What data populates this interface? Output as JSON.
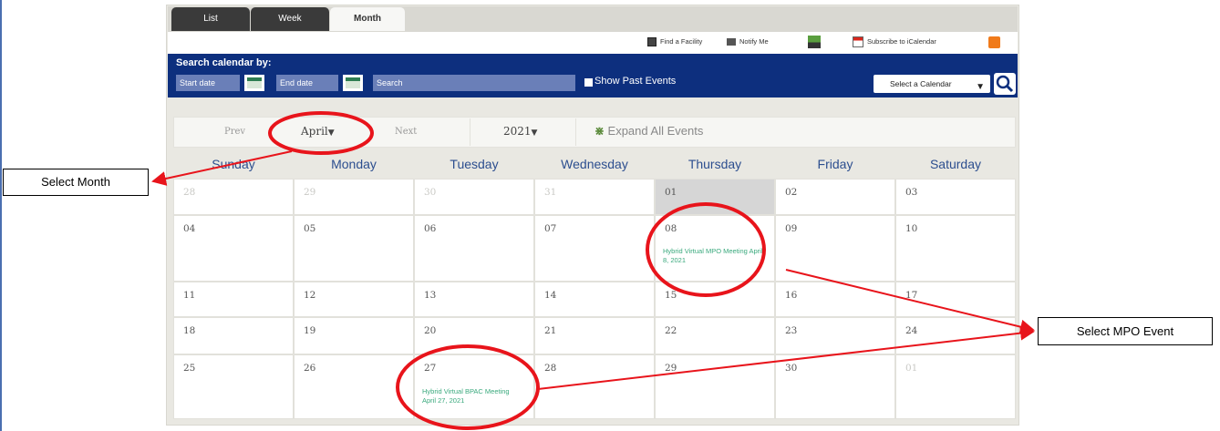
{
  "tabs": [
    {
      "label": "List",
      "state": "inactive"
    },
    {
      "label": "Week",
      "state": "inactive"
    },
    {
      "label": "Month",
      "state": "active"
    }
  ],
  "tools": {
    "find_facility": "Find a Facility",
    "notify_me": "Notify Me",
    "subscribe": "Subscribe to iCalendar"
  },
  "search": {
    "title": "Search calendar by:",
    "start_date": "Start date",
    "end_date": "End date",
    "search_placeholder": "Search",
    "show_past_label": "Show Past Events",
    "show_past_checked": false,
    "select_calendar": "Select a Calendar"
  },
  "nav": {
    "prev": "Prev",
    "month": "April",
    "next": "Next",
    "year": "2021",
    "expand": "Expand All Events"
  },
  "weekdays": [
    "Sunday",
    "Monday",
    "Tuesday",
    "Wednesday",
    "Thursday",
    "Friday",
    "Saturday"
  ],
  "weeks": [
    [
      "28",
      "29",
      "30",
      "31",
      "01",
      "02",
      "03"
    ],
    [
      "04",
      "05",
      "06",
      "07",
      "08",
      "09",
      "10"
    ],
    [
      "11",
      "12",
      "13",
      "14",
      "15",
      "16",
      "17"
    ],
    [
      "18",
      "19",
      "20",
      "21",
      "22",
      "23",
      "24"
    ],
    [
      "25",
      "26",
      "27",
      "28",
      "29",
      "30",
      "01"
    ]
  ],
  "events": {
    "mpo": "Hybrid Virtual MPO Meeting April 8, 2021",
    "bpac": "Hybrid Virtual BPAC Meeting April 27, 2021"
  },
  "annotations": {
    "select_month": "Select Month",
    "select_mpo": "Select MPO Event"
  },
  "colors": {
    "search_band": "#0d2f7e",
    "weekday_text": "#2c4e8f",
    "event_text": "#3aa97d",
    "annotation": "#e8141b"
  }
}
